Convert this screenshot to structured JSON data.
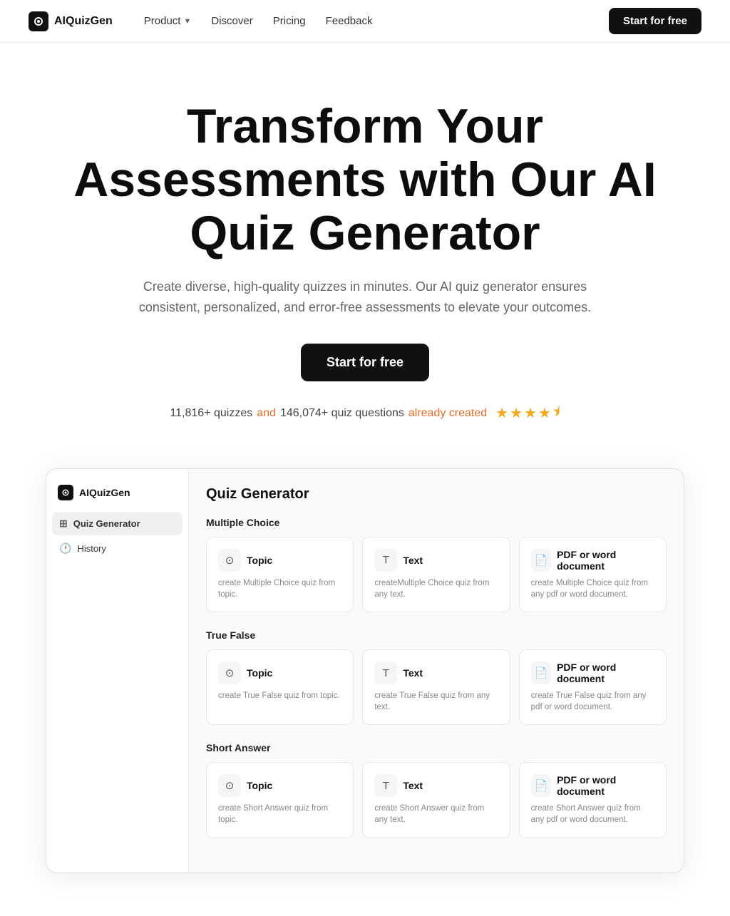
{
  "brand": {
    "name": "AIQuizGen",
    "logo_aria": "AIQuizGen logo"
  },
  "nav": {
    "links": [
      {
        "label": "Product",
        "has_chevron": true
      },
      {
        "label": "Discover",
        "has_chevron": false
      },
      {
        "label": "Pricing",
        "has_chevron": false
      },
      {
        "label": "Feedback",
        "has_chevron": false
      }
    ],
    "cta_label": "Start for free"
  },
  "hero": {
    "title": "Transform Your Assessments with Our AI Quiz Generator",
    "subtitle": "Create diverse, high-quality quizzes in minutes. Our AI quiz generator ensures consistent, personalized, and error-free assessments to elevate your outcomes.",
    "cta_label": "Start for free",
    "stats_prefix": "11,816+ quizzes",
    "stats_and": "and",
    "stats_mid": "146,074+ quiz questions",
    "stats_suffix": "already created",
    "rating": "4.5"
  },
  "app_preview": {
    "sidebar": {
      "brand": "AIQuizGen",
      "items": [
        {
          "label": "Quiz Generator",
          "icon": "grid",
          "active": true
        },
        {
          "label": "History",
          "icon": "clock",
          "active": false
        }
      ]
    },
    "main": {
      "title": "Quiz Generator",
      "sections": [
        {
          "title": "Multiple Choice",
          "cards": [
            {
              "icon": "topic",
              "label": "Topic",
              "desc": "create Multiple Choice quiz from topic."
            },
            {
              "icon": "text",
              "label": "Text",
              "desc": "createMultiple Choice quiz from any text."
            },
            {
              "icon": "pdf",
              "label": "PDF or word document",
              "desc": "create Multiple Choice quiz from any pdf or word document."
            }
          ]
        },
        {
          "title": "True False",
          "cards": [
            {
              "icon": "topic",
              "label": "Topic",
              "desc": "create True False quiz from topic."
            },
            {
              "icon": "text",
              "label": "Text",
              "desc": "create True False quiz from any text."
            },
            {
              "icon": "pdf",
              "label": "PDF or word document",
              "desc": "create True False quiz from any pdf or word document."
            }
          ]
        },
        {
          "title": "Short Answer",
          "cards": [
            {
              "icon": "topic",
              "label": "Topic",
              "desc": "create Short Answer quiz from topic."
            },
            {
              "icon": "text",
              "label": "Text",
              "desc": "create Short Answer quiz from any text."
            },
            {
              "icon": "pdf",
              "label": "PDF or word document",
              "desc": "create Short Answer quiz from any pdf or word document."
            }
          ]
        }
      ]
    }
  }
}
